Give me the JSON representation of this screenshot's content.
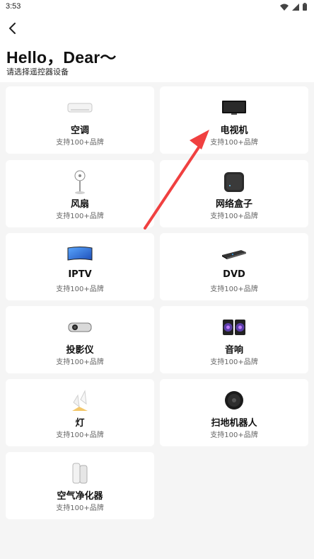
{
  "status_bar": {
    "time": "3:53"
  },
  "header": {
    "title": "Hello，Dear～",
    "subtitle": "请选择遥控器设备"
  },
  "devices": [
    {
      "name": "空调",
      "brands": "支持100+品牌",
      "icon": "air-conditioner-icon"
    },
    {
      "name": "电视机",
      "brands": "支持100+品牌",
      "icon": "tv-icon"
    },
    {
      "name": "风扇",
      "brands": "支持100+品牌",
      "icon": "fan-icon"
    },
    {
      "name": "网络盒子",
      "brands": "支持100+品牌",
      "icon": "network-box-icon"
    },
    {
      "name": "IPTV",
      "brands": "支持100+品牌",
      "icon": "iptv-icon"
    },
    {
      "name": "DVD",
      "brands": "支持100+品牌",
      "icon": "dvd-icon"
    },
    {
      "name": "投影仪",
      "brands": "支持100+品牌",
      "icon": "projector-icon"
    },
    {
      "name": "音响",
      "brands": "支持100+品牌",
      "icon": "speaker-icon"
    },
    {
      "name": "灯",
      "brands": "支持100+品牌",
      "icon": "lamp-icon"
    },
    {
      "name": "扫地机器人",
      "brands": "支持100+品牌",
      "icon": "robot-vacuum-icon"
    },
    {
      "name": "空气净化器",
      "brands": "支持100+品牌",
      "icon": "air-purifier-icon"
    }
  ],
  "colors": {
    "accent_arrow": "#f04040",
    "card_bg": "#ffffff",
    "page_bg": "#f5f5f5"
  }
}
